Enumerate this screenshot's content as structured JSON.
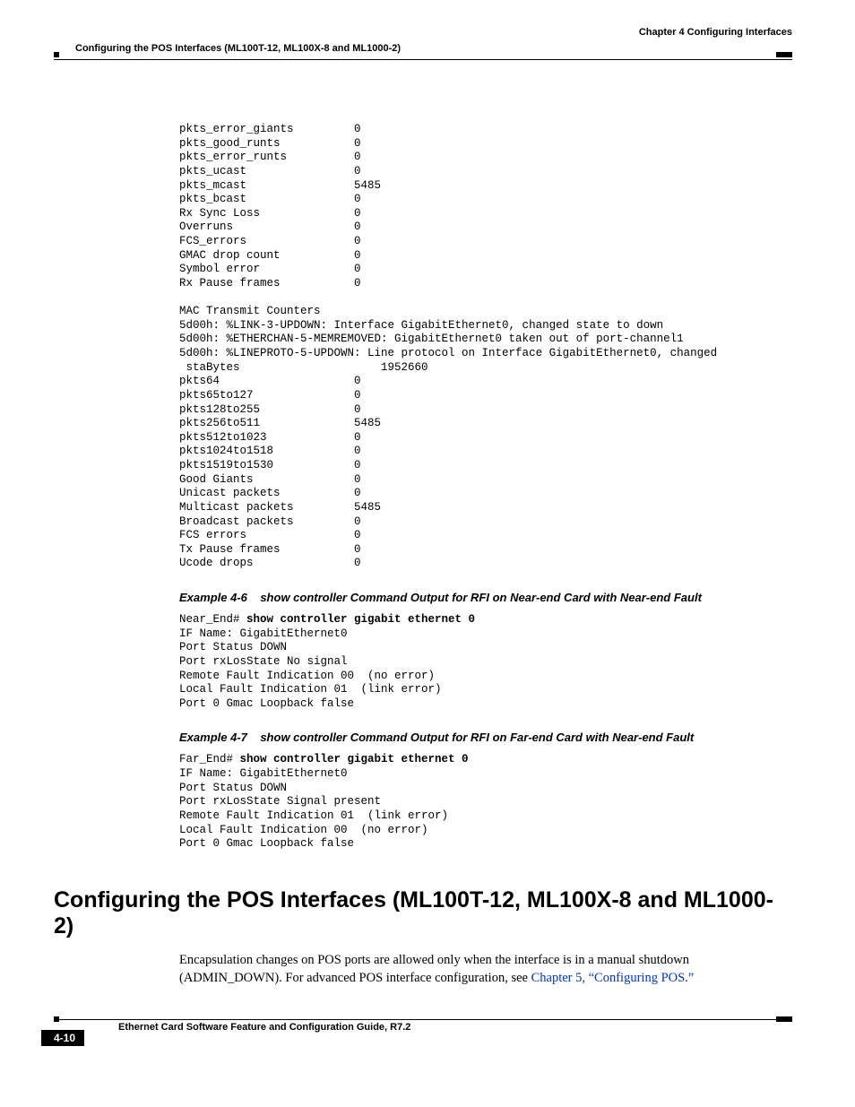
{
  "header": {
    "chapter": "Chapter 4    Configuring Interfaces",
    "section": "Configuring the POS Interfaces (ML100T-12, ML100X-8 and ML1000-2)"
  },
  "code_block_1": "pkts_error_giants         0\npkts_good_runts           0\npkts_error_runts          0\npkts_ucast                0\npkts_mcast                5485\npkts_bcast                0\nRx Sync Loss              0\nOverruns                  0\nFCS_errors                0\nGMAC drop count           0\nSymbol error              0\nRx Pause frames           0\n\nMAC Transmit Counters\n5d00h: %LINK-3-UPDOWN: Interface GigabitEthernet0, changed state to down\n5d00h: %ETHERCHAN-5-MEMREMOVED: GigabitEthernet0 taken out of port-channel1\n5d00h: %LINEPROTO-5-UPDOWN: Line protocol on Interface GigabitEthernet0, changed\n staBytes                     1952660\npkts64                    0\npkts65to127               0\npkts128to255              0\npkts256to511              5485\npkts512to1023             0\npkts1024to1518            0\npkts1519to1530            0\nGood Giants               0\nUnicast packets           0\nMulticast packets         5485\nBroadcast packets         0\nFCS errors                0\nTx Pause frames           0\nUcode drops               0",
  "example_4_6": {
    "label": "Example 4-6",
    "title": "show controller Command Output for RFI on Near-end Card with Near-end Fault",
    "prompt": "Near_End# ",
    "command": "show controller gigabit ethernet 0",
    "output": "IF Name: GigabitEthernet0\nPort Status DOWN\nPort rxLosState No signal\nRemote Fault Indication 00  (no error)\nLocal Fault Indication 01  (link error)\nPort 0 Gmac Loopback false"
  },
  "example_4_7": {
    "label": "Example 4-7",
    "title": "show controller Command Output for RFI on Far-end Card with Near-end Fault",
    "prompt": "Far_End# ",
    "command": "show controller gigabit ethernet 0",
    "output": "IF Name: GigabitEthernet0\nPort Status DOWN\nPort rxLosState Signal present\nRemote Fault Indication 01  (link error)\nLocal Fault Indication 00  (no error)\nPort 0 Gmac Loopback false"
  },
  "main_section": {
    "heading": "Configuring the POS Interfaces (ML100T-12, ML100X-8 and ML1000-2)",
    "para_part1": "Encapsulation changes on POS ports are allowed only when the interface is in a manual shutdown (ADMIN_DOWN). For advanced POS interface configuration, see ",
    "xref": "Chapter 5, “Configuring POS.”"
  },
  "footer": {
    "book": "Ethernet Card Software Feature and Configuration Guide, R7.2",
    "page": "4-10"
  }
}
